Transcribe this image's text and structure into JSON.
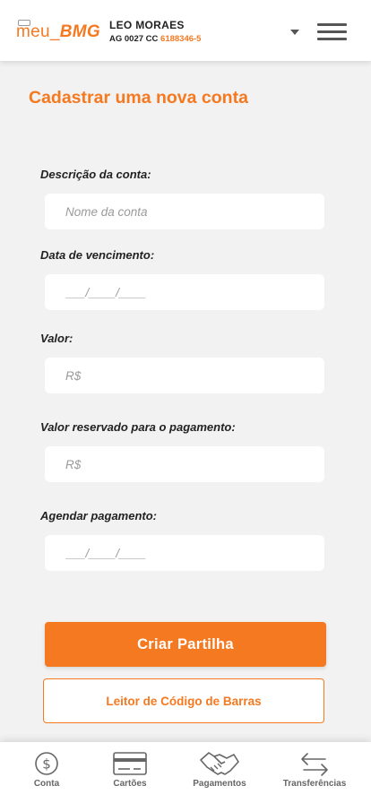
{
  "header": {
    "logo_meu": "meu_",
    "logo_bmg": "BMG",
    "user_name": "LEO MORAES",
    "agency_label": "AG 0027 CC ",
    "account_number": "6188346-5"
  },
  "main": {
    "title": "Cadastrar uma nova conta",
    "fields": [
      {
        "label": "Descrição da conta:",
        "placeholder": "Nome da conta"
      },
      {
        "label": "Data de vencimento:",
        "placeholder": "___/____/____"
      },
      {
        "label": "Valor:",
        "placeholder": "R$"
      },
      {
        "label": "Valor reservado para o pagamento:",
        "placeholder": "R$"
      },
      {
        "label": "Agendar pagamento:",
        "placeholder": "___/____/____"
      }
    ],
    "primary_button": "Criar Partilha",
    "secondary_button": "Leitor de Código de Barras"
  },
  "bottom_nav": {
    "items": [
      {
        "label": "Conta",
        "icon": "dollar-circle-icon"
      },
      {
        "label": "Cartões",
        "icon": "credit-card-icon"
      },
      {
        "label": "Pagamentos",
        "icon": "handshake-icon"
      },
      {
        "label": "Transferências",
        "icon": "transfer-arrows-icon"
      }
    ]
  },
  "colors": {
    "accent": "#f47920",
    "background": "#f2f2f2",
    "nav_text": "#666666"
  }
}
